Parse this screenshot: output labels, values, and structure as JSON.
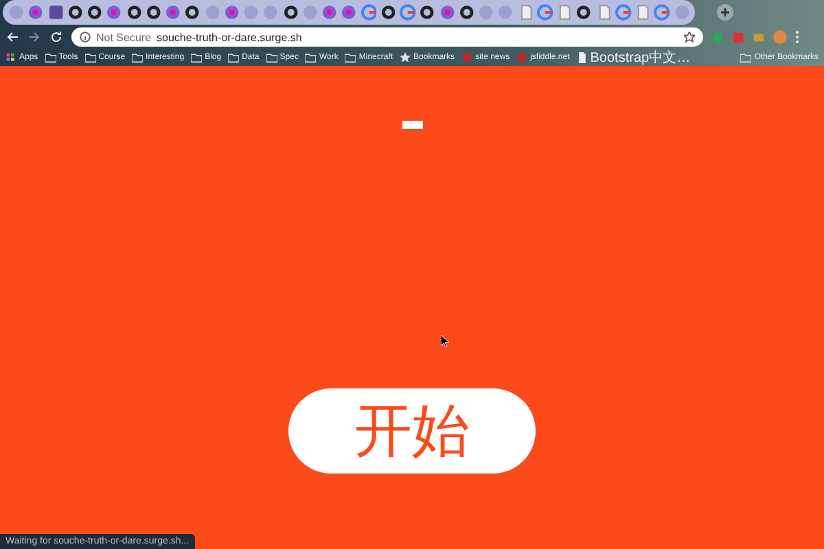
{
  "browser": {
    "tabs": [
      {
        "kind": "generic"
      },
      {
        "kind": "colorful"
      },
      {
        "kind": "letter"
      },
      {
        "kind": "github"
      },
      {
        "kind": "github"
      },
      {
        "kind": "colorful"
      },
      {
        "kind": "github"
      },
      {
        "kind": "github"
      },
      {
        "kind": "colorful"
      },
      {
        "kind": "github"
      },
      {
        "kind": "generic"
      },
      {
        "kind": "colorful"
      },
      {
        "kind": "generic"
      },
      {
        "kind": "generic"
      },
      {
        "kind": "github"
      },
      {
        "kind": "generic"
      },
      {
        "kind": "colorful"
      },
      {
        "kind": "colorful"
      },
      {
        "kind": "google"
      },
      {
        "kind": "github"
      },
      {
        "kind": "google"
      },
      {
        "kind": "github"
      },
      {
        "kind": "colorful"
      },
      {
        "kind": "github"
      },
      {
        "kind": "generic"
      },
      {
        "kind": "generic"
      },
      {
        "kind": "page"
      },
      {
        "kind": "google"
      },
      {
        "kind": "page"
      },
      {
        "kind": "github"
      },
      {
        "kind": "page"
      },
      {
        "kind": "google"
      },
      {
        "kind": "page"
      },
      {
        "kind": "google"
      },
      {
        "kind": "generic"
      }
    ],
    "security": "Not Secure",
    "url": "souche-truth-or-dare.surge.sh",
    "bookmarks": [
      {
        "label": "Apps",
        "kind": "apps"
      },
      {
        "label": "Tools",
        "kind": "folder"
      },
      {
        "label": "Course",
        "kind": "folder"
      },
      {
        "label": "Interesting",
        "kind": "folder"
      },
      {
        "label": "Blog",
        "kind": "folder"
      },
      {
        "label": "Data",
        "kind": "folder"
      },
      {
        "label": "Spec",
        "kind": "folder"
      },
      {
        "label": "Work",
        "kind": "folder"
      },
      {
        "label": "Minecraft",
        "kind": "folder"
      },
      {
        "label": "Bookmarks",
        "kind": "star"
      },
      {
        "label": "site news",
        "kind": "site"
      },
      {
        "label": "jsfiddle.net",
        "kind": "site"
      },
      {
        "label": "Bootstrap中文…",
        "kind": "page"
      }
    ],
    "other_bookmarks": "Other Bookmarks",
    "status": "Waiting for souche-truth-or-dare.surge.sh..."
  },
  "page": {
    "start_button": "开始"
  }
}
